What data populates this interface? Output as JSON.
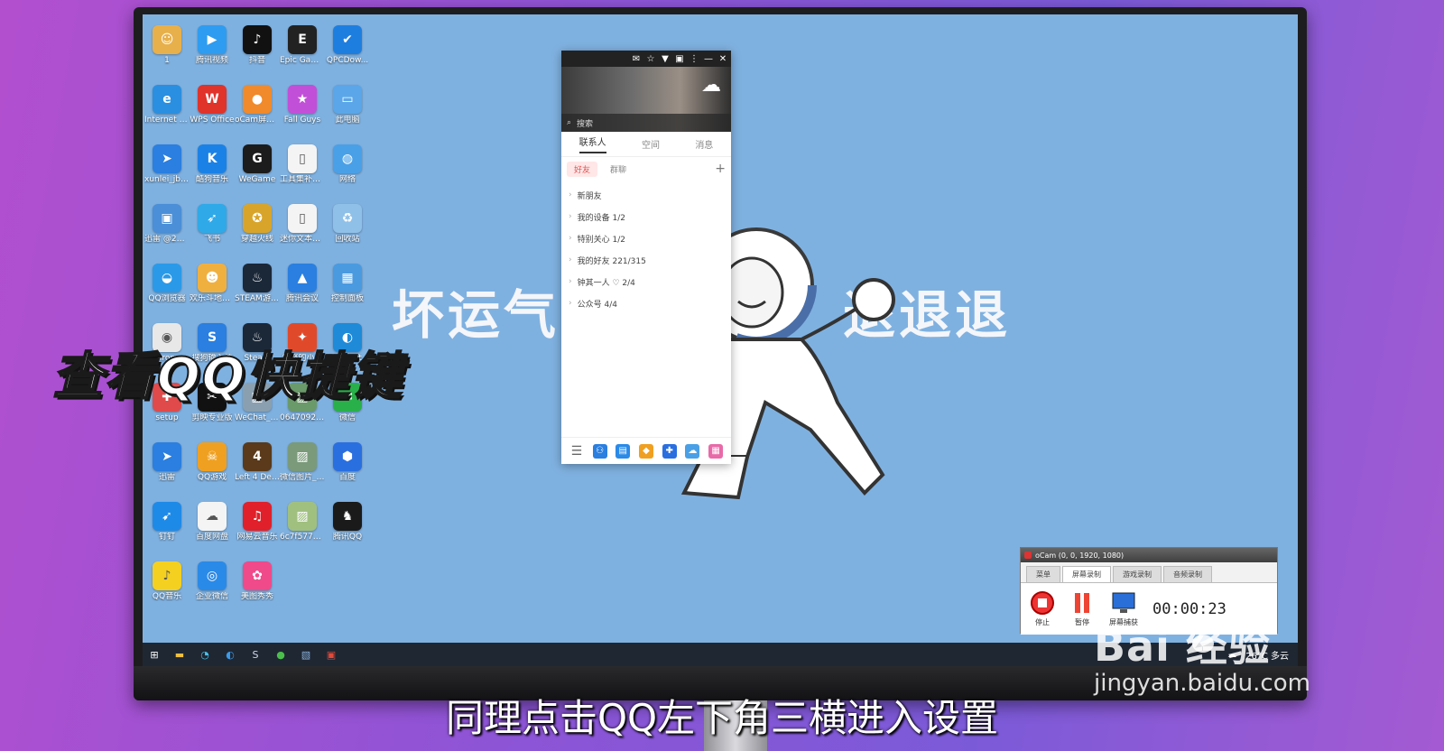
{
  "overlay": {
    "title": "查看QQ快捷键",
    "subtitle": "同理点击QQ左下角三横进入设置"
  },
  "watermark": {
    "brand": "Bai  经验",
    "url": "jingyan.baidu.com"
  },
  "wallpaper": {
    "left_text": "坏运气",
    "right_text": "退退退"
  },
  "desktop_icons": [
    {
      "label": "1",
      "icon": "user-icon",
      "color": "#e8b04a"
    },
    {
      "label": "腾讯视频",
      "icon": "play-icon",
      "color": "#2e9cf0"
    },
    {
      "label": "抖音",
      "icon": "tiktok-icon",
      "color": "#111111"
    },
    {
      "label": "Epic Games Launcher",
      "icon": "epic-icon",
      "color": "#222222"
    },
    {
      "label": "QPCDow...",
      "icon": "shield-icon",
      "color": "#1e7ee0"
    },
    {
      "label": "Internet Explorer",
      "icon": "ie-icon",
      "color": "#2a8fe0"
    },
    {
      "label": "WPS Office",
      "icon": "wps-icon",
      "color": "#e0332a"
    },
    {
      "label": "oCam屏幕录像",
      "icon": "ocam-icon",
      "color": "#f08a2a"
    },
    {
      "label": "Fall Guys",
      "icon": "fallguys-icon",
      "color": "#c24fd8"
    },
    {
      "label": "此电脑",
      "icon": "computer-icon",
      "color": "#5aa6e8"
    },
    {
      "label": "xunlei_jbo...",
      "icon": "xunlei-icon",
      "color": "#2a7fe0"
    },
    {
      "label": "酷狗音乐",
      "icon": "kugou-icon",
      "color": "#1a82e6"
    },
    {
      "label": "WeGame",
      "icon": "wegame-icon",
      "color": "#1c1c1c"
    },
    {
      "label": "工具集补丁...",
      "icon": "file-icon",
      "color": "#f4f4f4"
    },
    {
      "label": "网络",
      "icon": "network-icon",
      "color": "#4aa0e6"
    },
    {
      "label": "迅雷 @27906...",
      "icon": "xunlei2-icon",
      "color": "#4a8fd8"
    },
    {
      "label": "飞书",
      "icon": "feishu-icon",
      "color": "#2fa9e8"
    },
    {
      "label": "穿越火线",
      "icon": "cf-icon",
      "color": "#d8a52a"
    },
    {
      "label": "迷你文本播放",
      "icon": "file2-icon",
      "color": "#f4f4f4"
    },
    {
      "label": "回收站",
      "icon": "trash-icon",
      "color": "#8fc0e8"
    },
    {
      "label": "QQ浏览器",
      "icon": "qqbrowser-icon",
      "color": "#2a9ae8"
    },
    {
      "label": "欢乐斗地主(手游电脑版)",
      "icon": "doudizhu-icon",
      "color": "#f0b040"
    },
    {
      "label": "STEAM游戏中心",
      "icon": "steam-icon",
      "color": "#1b2838"
    },
    {
      "label": "腾讯会议",
      "icon": "meeting-icon",
      "color": "#2a7fe0"
    },
    {
      "label": "控制面板",
      "icon": "control-icon",
      "color": "#4a9ae0"
    },
    {
      "label": "Chrome",
      "icon": "chrome-icon",
      "color": "#e8e8e8"
    },
    {
      "label": "搜狗输入法",
      "icon": "sogou-icon",
      "color": "#2a7fe0"
    },
    {
      "label": "Steam",
      "icon": "steam2-icon",
      "color": "#1b2838"
    },
    {
      "label": "愤怒的小鸟",
      "icon": "bird-icon",
      "color": "#e04a2a"
    },
    {
      "label": "Microsoft Edge",
      "icon": "edge-icon",
      "color": "#1e8ad8"
    },
    {
      "label": "setup",
      "icon": "setup-icon",
      "color": "#e04a4a"
    },
    {
      "label": "剪映专业版",
      "icon": "capcut-icon",
      "color": "#111111"
    },
    {
      "label": "WeChat_2...",
      "icon": "image-icon",
      "color": "#8aa0b0"
    },
    {
      "label": "06470926...",
      "icon": "image2-icon",
      "color": "#6a9a6a"
    },
    {
      "label": "微信",
      "icon": "wechat-icon",
      "color": "#2ab04a"
    },
    {
      "label": "迅雷",
      "icon": "xunlei3-icon",
      "color": "#2a7fe0"
    },
    {
      "label": "QQ游戏",
      "icon": "qqgame-icon",
      "color": "#f0a020"
    },
    {
      "label": "Left 4 Dead 2",
      "icon": "l4d2-icon",
      "color": "#5a3a1a"
    },
    {
      "label": "微信图片_2022030...",
      "icon": "image3-icon",
      "color": "#7a9a7a"
    },
    {
      "label": "百度",
      "icon": "baidu-icon",
      "color": "#2a6fe0"
    },
    {
      "label": "钉钉",
      "icon": "dingtalk-icon",
      "color": "#1e8ae8"
    },
    {
      "label": "百度网盘",
      "icon": "netdisk-icon",
      "color": "#f4f4f4"
    },
    {
      "label": "网易云音乐",
      "icon": "music-icon",
      "color": "#e0202a"
    },
    {
      "label": "6c7f5776...",
      "icon": "image4-icon",
      "color": "#a0c080"
    },
    {
      "label": "腾讯QQ",
      "icon": "qq-icon",
      "color": "#1a1a1a"
    },
    {
      "label": "QQ音乐",
      "icon": "qqmusic-icon",
      "color": "#f4d020"
    },
    {
      "label": "企业微信",
      "icon": "wework-icon",
      "color": "#2a8ae8"
    },
    {
      "label": "美图秀秀",
      "icon": "meitu-icon",
      "color": "#f04a8a"
    }
  ],
  "qq": {
    "search_placeholder": "搜索",
    "tabs": [
      "联系人",
      "空间",
      "消息"
    ],
    "subtabs": [
      "好友",
      "群聊"
    ],
    "groups": [
      {
        "label": "新朋友"
      },
      {
        "label": "我的设备 1/2"
      },
      {
        "label": "特别关心 1/2"
      },
      {
        "label": "我的好友 221/315"
      },
      {
        "label": "钟其一人 ♡ 2/4"
      },
      {
        "label": "公众号 4/4"
      }
    ]
  },
  "ocam": {
    "title": "oCam (0, 0, 1920, 1080)",
    "tabs": [
      "菜单",
      "屏幕录制",
      "游戏录制",
      "音频录制"
    ],
    "buttons": [
      "停止",
      "暂停",
      "屏幕捕获"
    ],
    "timer": "00:00:23"
  },
  "taskbar": {
    "weather": "26°C 多云"
  }
}
